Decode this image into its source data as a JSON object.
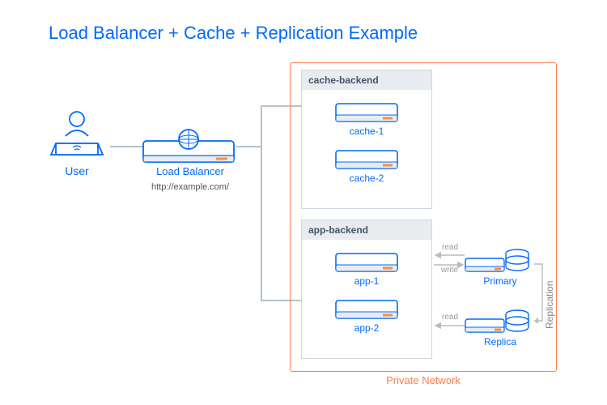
{
  "title": "Load Balancer + Cache + Replication Example",
  "user": {
    "label": "User"
  },
  "load_balancer": {
    "label": "Load Balancer",
    "url": "http://example.com/"
  },
  "private_network": {
    "label": "Private Network"
  },
  "cache_backend": {
    "header": "cache-backend",
    "servers": [
      "cache-1",
      "cache-2"
    ]
  },
  "app_backend": {
    "header": "app-backend",
    "servers": [
      "app-1",
      "app-2"
    ]
  },
  "db": {
    "primary": "Primary",
    "replica": "Replica",
    "replication_label": "Replication",
    "read_label": "read",
    "write_label": "write"
  }
}
